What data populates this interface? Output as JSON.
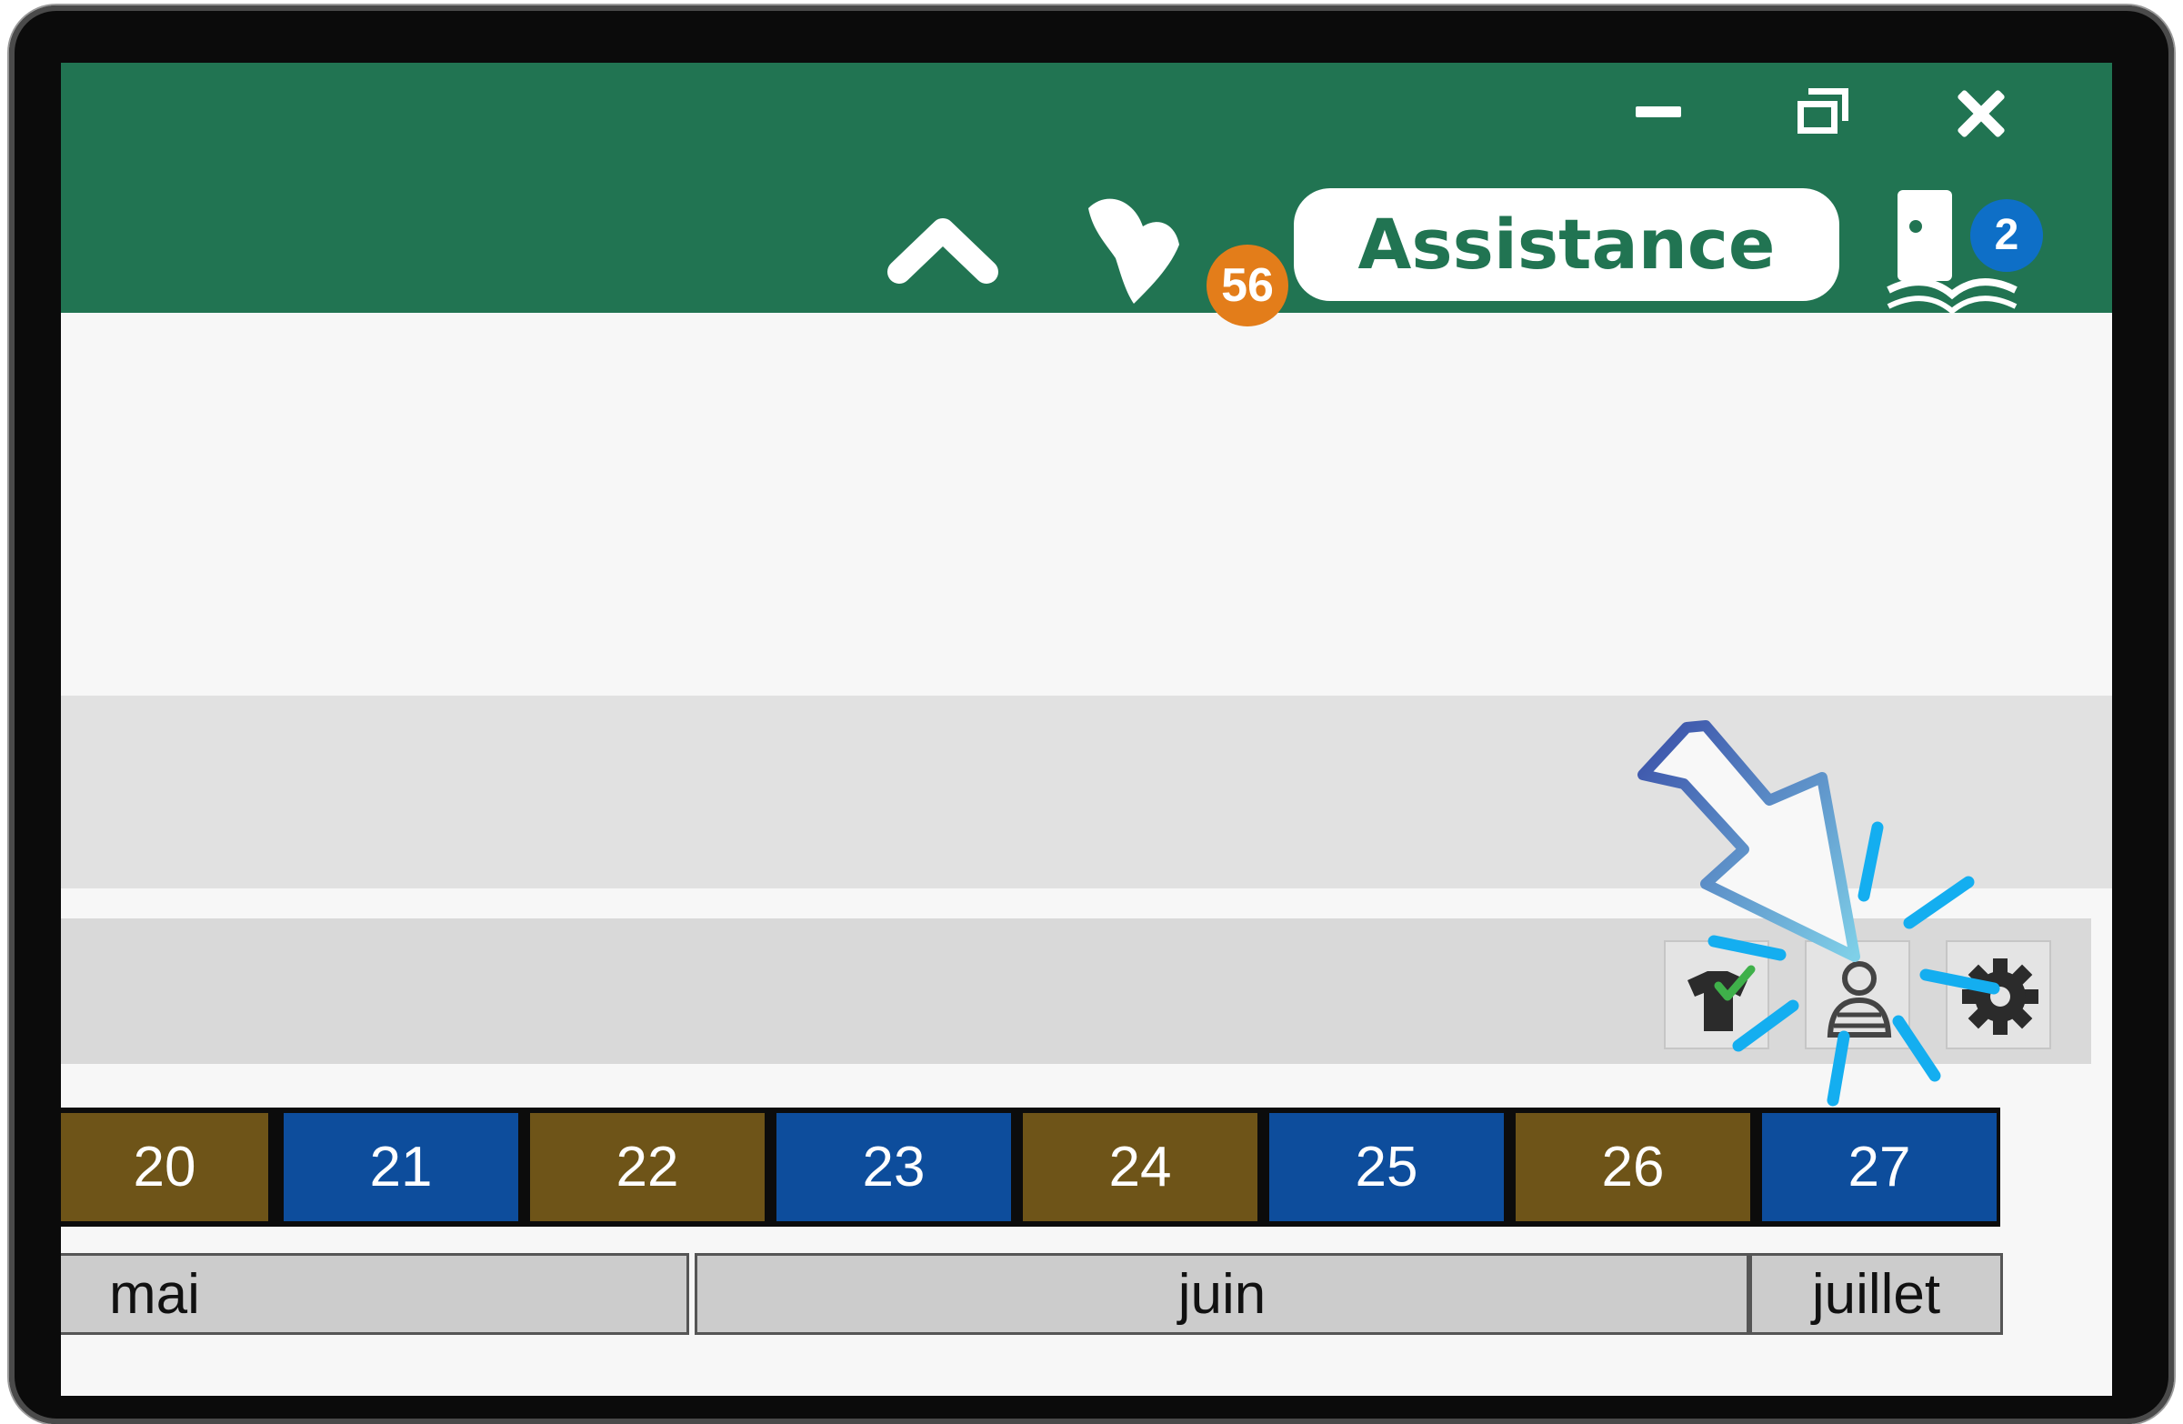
{
  "header": {
    "assistance_label": "Assistance",
    "notifications_count": "56",
    "help_count": "2"
  },
  "weeks": [
    {
      "label": "20",
      "color": "#6e5418"
    },
    {
      "label": "21",
      "color": "#0d4d9c"
    },
    {
      "label": "22",
      "color": "#6e5418"
    },
    {
      "label": "23",
      "color": "#0d4d9c"
    },
    {
      "label": "24",
      "color": "#6e5418"
    },
    {
      "label": "25",
      "color": "#0d4d9c"
    },
    {
      "label": "26",
      "color": "#6e5418"
    },
    {
      "label": "27",
      "color": "#0d4d9c"
    }
  ],
  "months": [
    {
      "label": "mai"
    },
    {
      "label": "juin"
    },
    {
      "label": "juillet"
    }
  ],
  "colors": {
    "title_bar": "#217452",
    "week_gold": "#6e5418",
    "week_blue": "#0d4d9c",
    "notif_badge": "#e37d1a",
    "help_badge": "#0e6fc7",
    "highlight": "#14aef0"
  },
  "icons": {
    "minimize": "minimize-icon",
    "restore": "restore-icon",
    "close": "close-icon",
    "collapse": "chevron-up-icon",
    "notifications": "bird-icon",
    "help": "reader-icon",
    "tool_1": "shirt-check-icon",
    "tool_2": "person-icon",
    "tool_3": "gear-icon"
  }
}
